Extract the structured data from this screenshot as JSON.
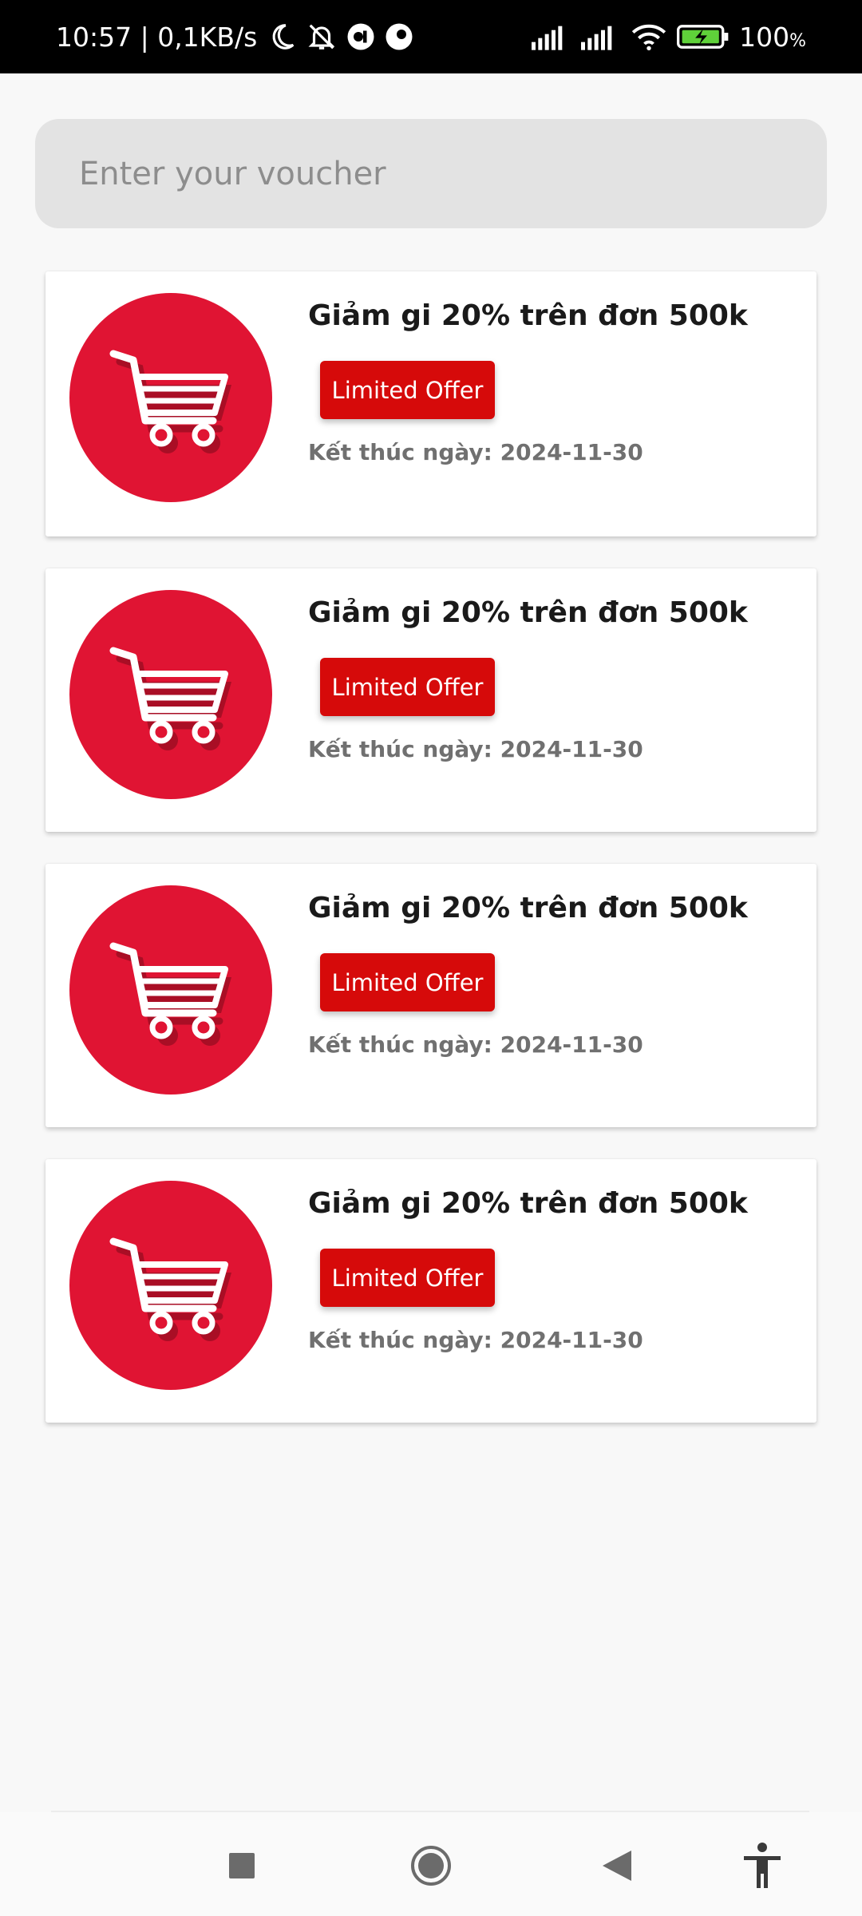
{
  "status_bar": {
    "time_speed": "10:57 | 0,1KB/s",
    "battery": "100",
    "battery_unit": "%",
    "icons": [
      "moon-icon",
      "bell-off-icon",
      "app-notif-icon",
      "app-notif-icon",
      "signal-icon",
      "signal-icon",
      "wifi-icon",
      "battery-charging-icon"
    ]
  },
  "search": {
    "placeholder": "Enter your voucher",
    "value": ""
  },
  "vouchers": [
    {
      "title": "Giảm gi 20% trên đơn 500k",
      "badge": "Limited Offer",
      "end_date": "Kết thúc ngày: 2024-11-30",
      "icon": "shopping-cart-icon"
    },
    {
      "title": "Giảm gi 20% trên đơn 500k",
      "badge": "Limited Offer",
      "end_date": "Kết thúc ngày: 2024-11-30",
      "icon": "shopping-cart-icon"
    },
    {
      "title": "Giảm gi 20% trên đơn 500k",
      "badge": "Limited Offer",
      "end_date": "Kết thúc ngày: 2024-11-30",
      "icon": "shopping-cart-icon"
    },
    {
      "title": "Giảm gi 20% trên đơn 500k",
      "badge": "Limited Offer",
      "end_date": "Kết thúc ngày: 2024-11-30",
      "icon": "shopping-cart-icon"
    }
  ],
  "nav": {
    "buttons": [
      "recents-icon",
      "home-icon",
      "back-icon",
      "accessibility-icon"
    ]
  },
  "colors": {
    "accent_red": "#d60a0a",
    "icon_circle_red": "#e01433",
    "search_bg": "#e3e3e3",
    "background": "#f8f8f8"
  }
}
